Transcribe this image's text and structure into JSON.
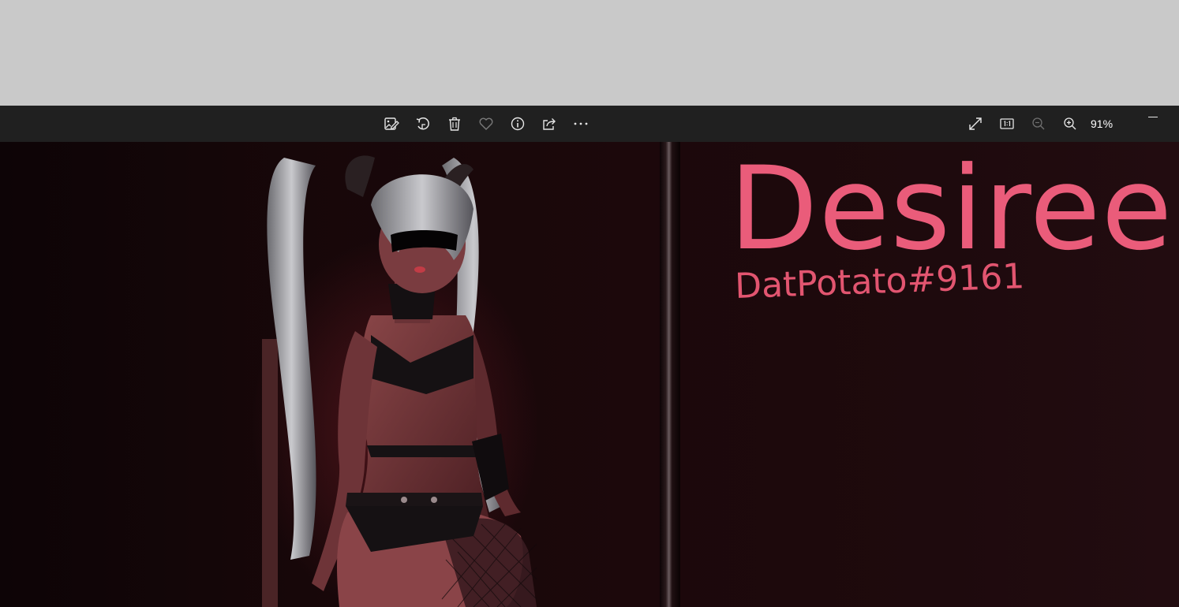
{
  "toolbar": {
    "left_icons": [
      {
        "name": "edit-image-icon"
      },
      {
        "name": "rotate-icon"
      },
      {
        "name": "delete-icon"
      },
      {
        "name": "favorite-icon"
      },
      {
        "name": "info-icon"
      },
      {
        "name": "share-icon"
      },
      {
        "name": "more-options-icon"
      }
    ],
    "right_icons": [
      {
        "name": "fullscreen-icon"
      },
      {
        "name": "actual-size-icon"
      },
      {
        "name": "zoom-out-icon"
      },
      {
        "name": "zoom-in-icon"
      }
    ],
    "zoom_level": "91%"
  },
  "image": {
    "title_text": "Desiree",
    "subtitle_text": "DatPotato#9161",
    "title_color": "#ea5c7a"
  }
}
